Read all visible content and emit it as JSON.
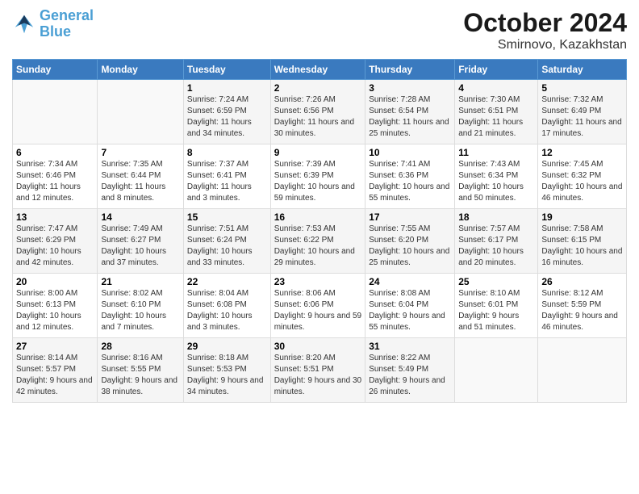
{
  "logo": {
    "line1": "General",
    "line2": "Blue"
  },
  "title": "October 2024",
  "location": "Smirnovo, Kazakhstan",
  "days_header": [
    "Sunday",
    "Monday",
    "Tuesday",
    "Wednesday",
    "Thursday",
    "Friday",
    "Saturday"
  ],
  "weeks": [
    [
      {
        "day": "",
        "sunrise": "",
        "sunset": "",
        "daylight": ""
      },
      {
        "day": "",
        "sunrise": "",
        "sunset": "",
        "daylight": ""
      },
      {
        "day": "1",
        "sunrise": "Sunrise: 7:24 AM",
        "sunset": "Sunset: 6:59 PM",
        "daylight": "Daylight: 11 hours and 34 minutes."
      },
      {
        "day": "2",
        "sunrise": "Sunrise: 7:26 AM",
        "sunset": "Sunset: 6:56 PM",
        "daylight": "Daylight: 11 hours and 30 minutes."
      },
      {
        "day": "3",
        "sunrise": "Sunrise: 7:28 AM",
        "sunset": "Sunset: 6:54 PM",
        "daylight": "Daylight: 11 hours and 25 minutes."
      },
      {
        "day": "4",
        "sunrise": "Sunrise: 7:30 AM",
        "sunset": "Sunset: 6:51 PM",
        "daylight": "Daylight: 11 hours and 21 minutes."
      },
      {
        "day": "5",
        "sunrise": "Sunrise: 7:32 AM",
        "sunset": "Sunset: 6:49 PM",
        "daylight": "Daylight: 11 hours and 17 minutes."
      }
    ],
    [
      {
        "day": "6",
        "sunrise": "Sunrise: 7:34 AM",
        "sunset": "Sunset: 6:46 PM",
        "daylight": "Daylight: 11 hours and 12 minutes."
      },
      {
        "day": "7",
        "sunrise": "Sunrise: 7:35 AM",
        "sunset": "Sunset: 6:44 PM",
        "daylight": "Daylight: 11 hours and 8 minutes."
      },
      {
        "day": "8",
        "sunrise": "Sunrise: 7:37 AM",
        "sunset": "Sunset: 6:41 PM",
        "daylight": "Daylight: 11 hours and 3 minutes."
      },
      {
        "day": "9",
        "sunrise": "Sunrise: 7:39 AM",
        "sunset": "Sunset: 6:39 PM",
        "daylight": "Daylight: 10 hours and 59 minutes."
      },
      {
        "day": "10",
        "sunrise": "Sunrise: 7:41 AM",
        "sunset": "Sunset: 6:36 PM",
        "daylight": "Daylight: 10 hours and 55 minutes."
      },
      {
        "day": "11",
        "sunrise": "Sunrise: 7:43 AM",
        "sunset": "Sunset: 6:34 PM",
        "daylight": "Daylight: 10 hours and 50 minutes."
      },
      {
        "day": "12",
        "sunrise": "Sunrise: 7:45 AM",
        "sunset": "Sunset: 6:32 PM",
        "daylight": "Daylight: 10 hours and 46 minutes."
      }
    ],
    [
      {
        "day": "13",
        "sunrise": "Sunrise: 7:47 AM",
        "sunset": "Sunset: 6:29 PM",
        "daylight": "Daylight: 10 hours and 42 minutes."
      },
      {
        "day": "14",
        "sunrise": "Sunrise: 7:49 AM",
        "sunset": "Sunset: 6:27 PM",
        "daylight": "Daylight: 10 hours and 37 minutes."
      },
      {
        "day": "15",
        "sunrise": "Sunrise: 7:51 AM",
        "sunset": "Sunset: 6:24 PM",
        "daylight": "Daylight: 10 hours and 33 minutes."
      },
      {
        "day": "16",
        "sunrise": "Sunrise: 7:53 AM",
        "sunset": "Sunset: 6:22 PM",
        "daylight": "Daylight: 10 hours and 29 minutes."
      },
      {
        "day": "17",
        "sunrise": "Sunrise: 7:55 AM",
        "sunset": "Sunset: 6:20 PM",
        "daylight": "Daylight: 10 hours and 25 minutes."
      },
      {
        "day": "18",
        "sunrise": "Sunrise: 7:57 AM",
        "sunset": "Sunset: 6:17 PM",
        "daylight": "Daylight: 10 hours and 20 minutes."
      },
      {
        "day": "19",
        "sunrise": "Sunrise: 7:58 AM",
        "sunset": "Sunset: 6:15 PM",
        "daylight": "Daylight: 10 hours and 16 minutes."
      }
    ],
    [
      {
        "day": "20",
        "sunrise": "Sunrise: 8:00 AM",
        "sunset": "Sunset: 6:13 PM",
        "daylight": "Daylight: 10 hours and 12 minutes."
      },
      {
        "day": "21",
        "sunrise": "Sunrise: 8:02 AM",
        "sunset": "Sunset: 6:10 PM",
        "daylight": "Daylight: 10 hours and 7 minutes."
      },
      {
        "day": "22",
        "sunrise": "Sunrise: 8:04 AM",
        "sunset": "Sunset: 6:08 PM",
        "daylight": "Daylight: 10 hours and 3 minutes."
      },
      {
        "day": "23",
        "sunrise": "Sunrise: 8:06 AM",
        "sunset": "Sunset: 6:06 PM",
        "daylight": "Daylight: 9 hours and 59 minutes."
      },
      {
        "day": "24",
        "sunrise": "Sunrise: 8:08 AM",
        "sunset": "Sunset: 6:04 PM",
        "daylight": "Daylight: 9 hours and 55 minutes."
      },
      {
        "day": "25",
        "sunrise": "Sunrise: 8:10 AM",
        "sunset": "Sunset: 6:01 PM",
        "daylight": "Daylight: 9 hours and 51 minutes."
      },
      {
        "day": "26",
        "sunrise": "Sunrise: 8:12 AM",
        "sunset": "Sunset: 5:59 PM",
        "daylight": "Daylight: 9 hours and 46 minutes."
      }
    ],
    [
      {
        "day": "27",
        "sunrise": "Sunrise: 8:14 AM",
        "sunset": "Sunset: 5:57 PM",
        "daylight": "Daylight: 9 hours and 42 minutes."
      },
      {
        "day": "28",
        "sunrise": "Sunrise: 8:16 AM",
        "sunset": "Sunset: 5:55 PM",
        "daylight": "Daylight: 9 hours and 38 minutes."
      },
      {
        "day": "29",
        "sunrise": "Sunrise: 8:18 AM",
        "sunset": "Sunset: 5:53 PM",
        "daylight": "Daylight: 9 hours and 34 minutes."
      },
      {
        "day": "30",
        "sunrise": "Sunrise: 8:20 AM",
        "sunset": "Sunset: 5:51 PM",
        "daylight": "Daylight: 9 hours and 30 minutes."
      },
      {
        "day": "31",
        "sunrise": "Sunrise: 8:22 AM",
        "sunset": "Sunset: 5:49 PM",
        "daylight": "Daylight: 9 hours and 26 minutes."
      },
      {
        "day": "",
        "sunrise": "",
        "sunset": "",
        "daylight": ""
      },
      {
        "day": "",
        "sunrise": "",
        "sunset": "",
        "daylight": ""
      }
    ]
  ]
}
